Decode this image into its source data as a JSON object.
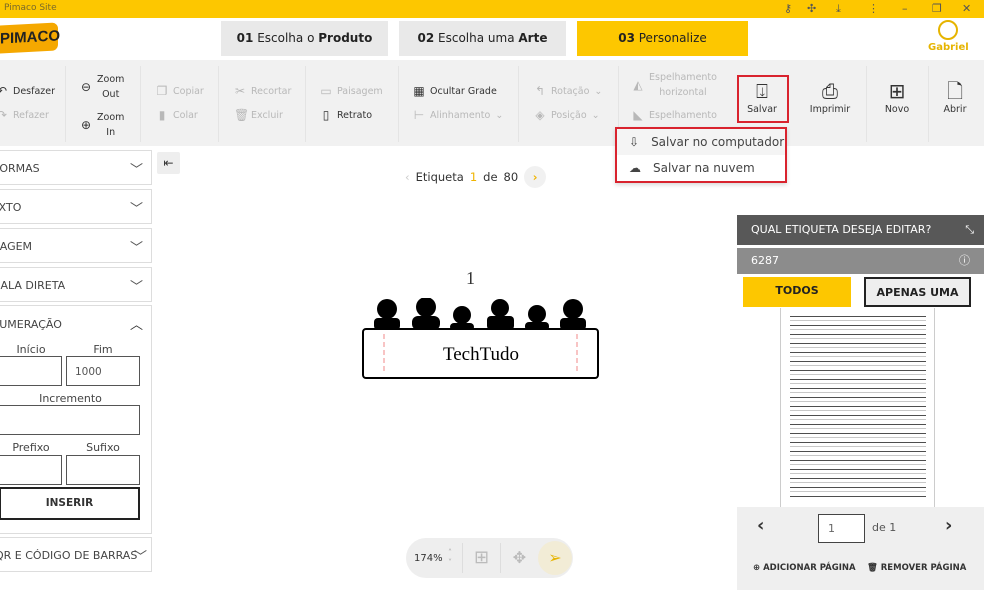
{
  "window": {
    "title": "Pimaco Site",
    "icons": [
      "key-icon",
      "puzzle-icon",
      "download-icon",
      "more-icon",
      "minimize-icon",
      "restore-icon",
      "close-icon"
    ]
  },
  "header": {
    "logo": "PIMACO",
    "steps": [
      {
        "num": "01",
        "pre": "Escolha o",
        "bold": "Produto",
        "active": false
      },
      {
        "num": "02",
        "pre": "Escolha uma",
        "bold": "Arte",
        "active": false
      },
      {
        "num": "03",
        "pre": "Personalize",
        "bold": "",
        "active": true
      }
    ],
    "user": "Gabriel"
  },
  "toolbar": {
    "desfazer": "Desfazer",
    "refazer": "Refazer",
    "zoom_out": [
      "Zoom",
      "Out"
    ],
    "zoom_in": [
      "Zoom",
      "In"
    ],
    "copiar": "Copiar",
    "colar": "Colar",
    "recortar": "Recortar",
    "excluir": "Excluir",
    "paisagem": "Paisagem",
    "retrato": "Retrato",
    "ocultar_grade": "Ocultar Grade",
    "alinhamento": "Alinhamento",
    "rotacao": "Rotação",
    "posicao": "Posição",
    "espelhamento_h": [
      "Espelhamento",
      "horizontal"
    ],
    "espelhamento_v": "Espelhamento",
    "salvar": "Salvar",
    "imprimir": "Imprimir",
    "novo": "Novo",
    "abrir": "Abrir"
  },
  "save_menu": {
    "items": [
      "Salvar no computador",
      "Salvar na nuvem"
    ]
  },
  "left_panel": {
    "sections": [
      "FORMAS",
      "TEXTO",
      "IMAGEM",
      "MALA DIRETA",
      "NUMERAÇÃO",
      "QR E CÓDIGO DE BARRAS"
    ],
    "numeracao": {
      "inicio_label": "Início",
      "inicio": "",
      "fim_label": "Fim",
      "fim": "1000",
      "incremento_label": "Incremento",
      "incremento": "",
      "prefixo_label": "Prefixo",
      "prefixo": "",
      "sufixo_label": "Sufixo",
      "sufixo": "",
      "insert": "INSERIR"
    }
  },
  "pager": {
    "label": "Etiqueta",
    "current": "1",
    "of": "de",
    "total": "80"
  },
  "canvas": {
    "number": "1",
    "text": "TechTudo"
  },
  "zoombar": {
    "zoom": "174%"
  },
  "right_panel": {
    "title": "QUAL ETIQUETA DESEJA EDITAR?",
    "code": "6287",
    "todos": "TODOS",
    "apenas": "APENAS UMA",
    "page": "1",
    "of": "de",
    "total": "1",
    "add": "ADICIONAR PÁGINA",
    "remove": "REMOVER PÁGINA"
  },
  "colors": {
    "accent": "#fdc700",
    "highlight": "#d9232e"
  }
}
